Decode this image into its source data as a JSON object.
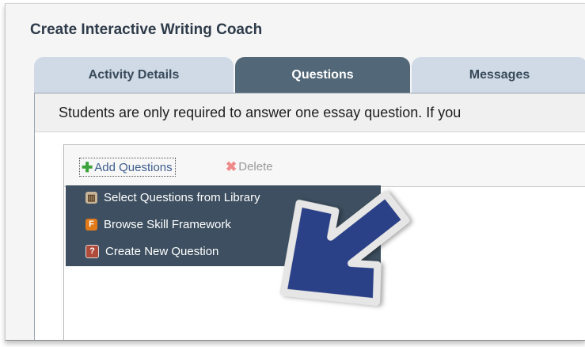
{
  "page": {
    "title": "Create Interactive Writing Coach"
  },
  "tabs": [
    {
      "label": "Activity Details",
      "active": false
    },
    {
      "label": "Questions",
      "active": true
    },
    {
      "label": "Messages",
      "active": false
    }
  ],
  "notice": {
    "text": "Students are only required to answer one essay question. If you"
  },
  "toolbar": {
    "add_label": "Add Questions",
    "add_icon": "plus-icon",
    "delete_label": "Delete",
    "delete_icon": "delete-x-icon"
  },
  "menu": {
    "items": [
      {
        "label": "Select Questions from Library",
        "icon": "book-icon"
      },
      {
        "label": "Browse Skill Framework",
        "icon": "framework-f-icon",
        "icon_text": "F"
      },
      {
        "label": "Create New Question",
        "icon": "question-icon",
        "icon_text": "?"
      }
    ]
  },
  "colors": {
    "active_tab": "#526777",
    "inactive_tab": "#cfdae6",
    "menu_bg": "#3d4f60",
    "arrow_fill": "#2c3f87"
  }
}
